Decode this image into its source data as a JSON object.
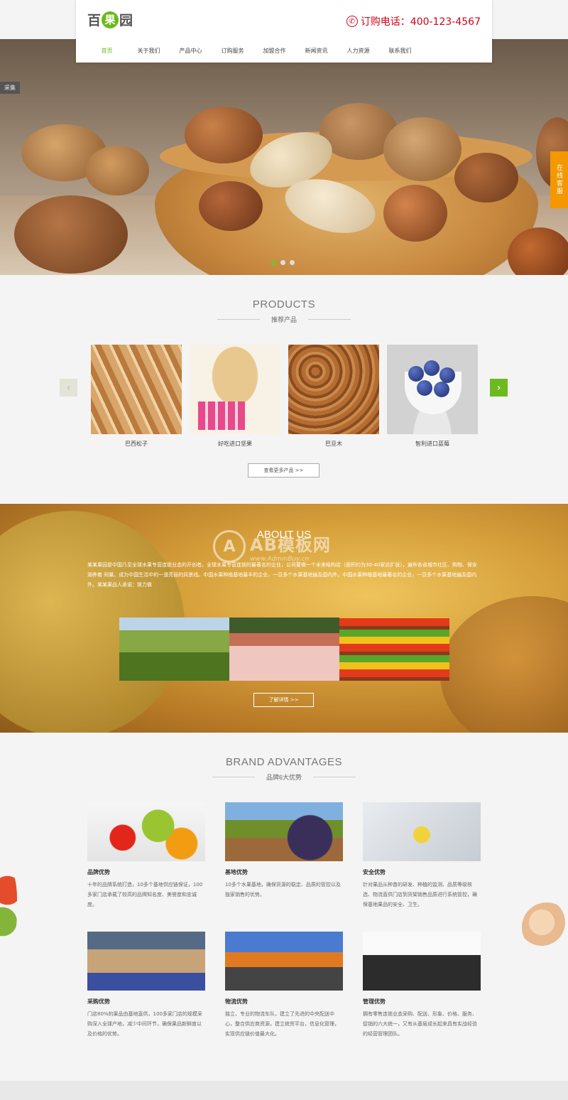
{
  "header": {
    "logo": {
      "part1": "百",
      "part2": "果",
      "part3": "园"
    },
    "phone": "订购电话：400-123-4567",
    "nav": [
      "首页",
      "关于我们",
      "产品中心",
      "订购服务",
      "加盟合作",
      "新闻资讯",
      "人力资源",
      "联系我们"
    ],
    "nav_active": 0
  },
  "hero": {
    "tag": "采集",
    "dots": 3,
    "active_dot": 0
  },
  "side_service": "在线客服",
  "products": {
    "title_en": "PRODUCTS",
    "title_cn": "推荐产品",
    "items": [
      {
        "name": "巴西松子"
      },
      {
        "name": "好吃进口坚果"
      },
      {
        "name": "巴旦木"
      },
      {
        "name": "智利进口蓝莓"
      }
    ],
    "more_btn": "查看更多产品 >>",
    "prev_arrow": "‹",
    "next_arrow": "›"
  },
  "about": {
    "title": "ABOUT US",
    "text": "某某果园是中国乃至全球水果专营连锁业态的开创者。全球水果专营连锁的最著名的企业，公司要做一个未来结构店（面积约为30-40家店扩张），遍布各省城市社区、购物、保安湖养着 同量。成为中国生活中的一道亮丽的风景线。中国水果种植基地最丰的企业，一百多个水果基地遍及国内外。中国水果种植基地最著名的企业，一百多个水果基地遍及国内外。某某果品人承诺：致力做",
    "btn": "了解详情 >>"
  },
  "watermark": {
    "logo": "A",
    "text": "AB模板网",
    "url": "www.AdminBuy.cn"
  },
  "advantages": {
    "title_en": "BRAND ADVANTAGES",
    "title_cn": "品牌6大优势",
    "items": [
      {
        "title": "品牌优势",
        "desc": "十年的品牌系统打造，10多个基地供应链保证，100多家门店承载了较高的品牌知名度、美誉度和忠诚度。"
      },
      {
        "title": "基地优势",
        "desc": "10多个水果基地，确保货源的稳定、品质的管控以及独家销售的优势。"
      },
      {
        "title": "安全优势",
        "desc": "针对果品从种苗的研发、种植的监测、品质等级核选、物流直供门店到货架销售品质进行系统管控，确保基地果品的安全、卫生。"
      },
      {
        "title": "采购优势",
        "desc": "门店80%的果品由基地直供，100多家门店的规模采购深入全球产地，减少中间环节，确保果品新鲜度以及价格的优势。"
      },
      {
        "title": "物流优势",
        "desc": "独立、专业的物流车队，建立了先进的中央配送中心，整合供应商资源，建立统贸平台，信息化管理，实现供应链价值最大化。"
      },
      {
        "title": "管理优势",
        "desc": "拥有零售连锁业态采购、配送、形象、价格、服务、促销的六大统一，又有从基层成长起来具有实战经验的经营管理团队。"
      }
    ]
  },
  "colors": {
    "accent": "#6cba1e",
    "phone": "#d0021b",
    "service": "#f39800"
  }
}
